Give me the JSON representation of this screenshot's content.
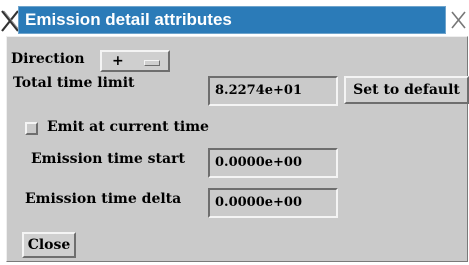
{
  "window": {
    "title": "Emission detail attributes"
  },
  "icons": {
    "app": "x-window-icon",
    "close": "close-icon"
  },
  "colors": {
    "titlebar": "#2b7bb8",
    "panel": "#cacaca"
  },
  "direction": {
    "label": "Direction",
    "value": "+"
  },
  "time_limit": {
    "label": "Total time limit",
    "value": "8.2274e+01",
    "default_button": "Set to default"
  },
  "emit_current": {
    "label": "Emit at current time",
    "checked": false
  },
  "emission_start": {
    "label": "Emission time start",
    "value": "0.0000e+00"
  },
  "emission_delta": {
    "label": "Emission time delta",
    "value": "0.0000e+00"
  },
  "close_button": "Close"
}
